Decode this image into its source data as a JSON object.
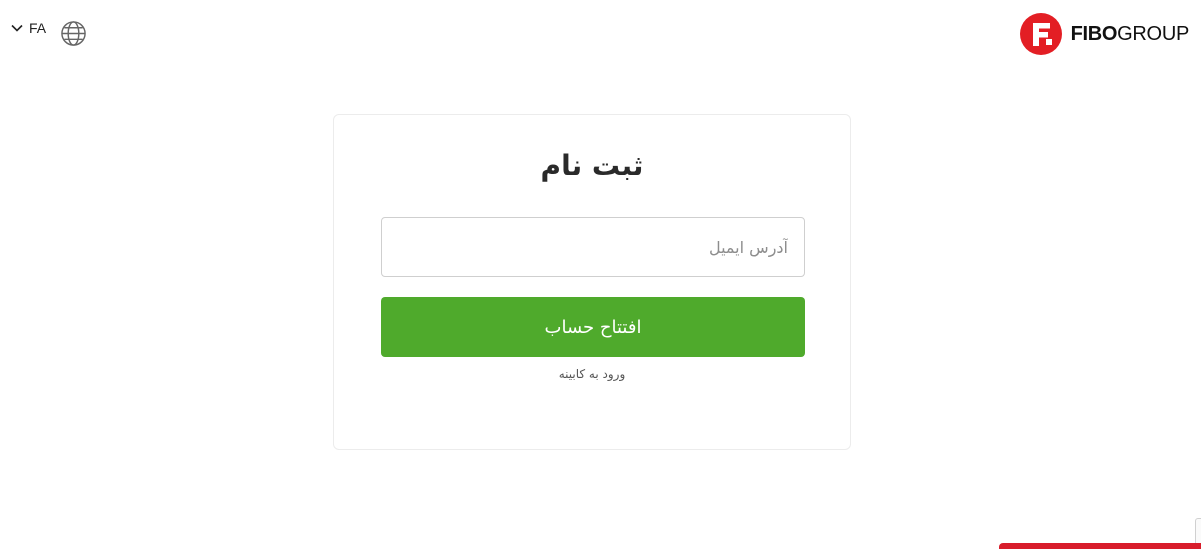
{
  "header": {
    "language": {
      "label": "FA",
      "icon": "chevron-down-icon"
    },
    "globe_icon": "globe-icon",
    "logo": {
      "brand_bold": "FIBO",
      "brand_regular": "GROUP",
      "brand_color": "#e31e24"
    }
  },
  "form": {
    "title": "ثبت نام",
    "email": {
      "placeholder": "آدرس ایمیل",
      "value": ""
    },
    "submit_label": "افتتاح حساب",
    "login_link": "ورود به کابینه"
  },
  "colors": {
    "accent_green": "#4faa2c",
    "brand_red": "#d81d2b"
  }
}
